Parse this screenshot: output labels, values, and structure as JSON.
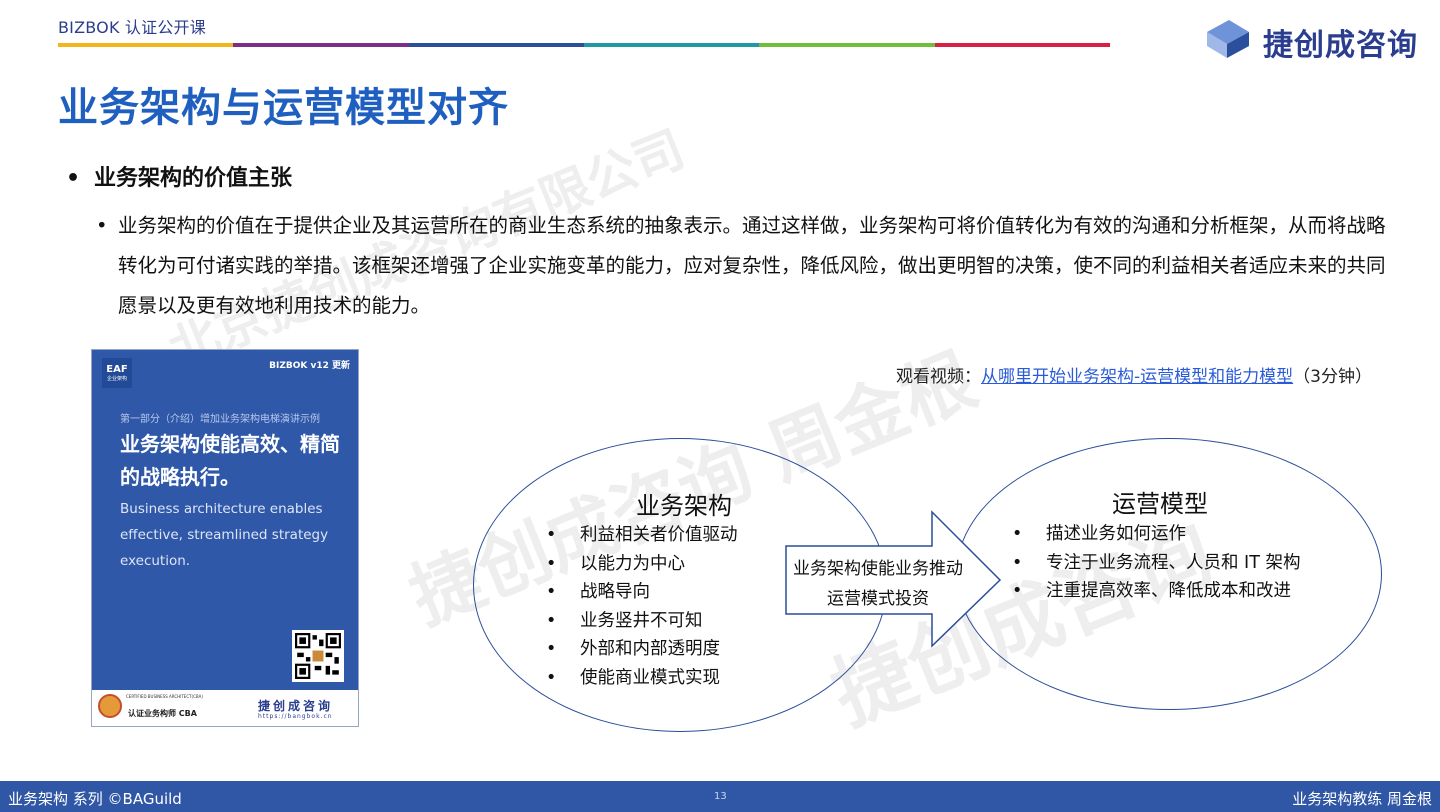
{
  "header": {
    "course_tag": "BIZBOK 认证公开课",
    "brand_name": "捷创成咨询",
    "rainbow_colors": [
      "#f2b51b",
      "#7d2d8a",
      "#2a4f9b",
      "#1f9aa5",
      "#6fbf3a",
      "#d81f44"
    ]
  },
  "title": "业务架构与运营模型对齐",
  "bullets": {
    "heading": "业务架构的价值主张",
    "body": "业务架构的价值在于提供企业及其运营所在的商业生态系统的抽象表示。通过这样做，业务架构可将价值转化为有效的沟通和分析框架，从而将战略转化为可付诸实践的举措。该框架还增强了企业实施变革的能力，应对复杂性，降低风险，做出更明智的决策，使不同的利益相关者适应未来的共同愿景以及更有效地利用技术的能力。"
  },
  "watermarks": [
    "北京捷创成咨询有限公司",
    "捷创成咨询 周金根",
    "捷创成咨询"
  ],
  "book": {
    "badge": "EAF",
    "badge_sub": "企业架构",
    "version": "BIZBOK v12 更新",
    "part": "第一部分（介绍）增加业务架构电梯演讲示例",
    "title": "业务架构使能高效、精简的战略执行。",
    "subtitle_en": "Business architecture enables effective, streamlined strategy execution.",
    "cert_small": "CERTIFIED BUSINESS ARCHITECT(CBA)",
    "cert": "认证业务构师 CBA",
    "brand": "捷创成咨询",
    "url": "https://bangbok.cn"
  },
  "video": {
    "prefix": "观看视频：",
    "link": "从哪里开始业务架构-运营模型和能力模型",
    "suffix": "（3分钟）"
  },
  "diagram": {
    "left_title": "业务架构",
    "left_items": [
      "利益相关者价值驱动",
      "以能力为中心",
      "战略导向",
      "业务竖井不可知",
      "外部和内部透明度",
      "使能商业模式实现"
    ],
    "arrow_text": "业务架构使能业务推动运营模式投资",
    "right_title": "运营模型",
    "right_items": [
      "描述业务如何运作",
      "专注于业务流程、人员和 IT 架构",
      "注重提高效率、降低成本和改进"
    ]
  },
  "footer": {
    "left": "业务架构 系列 ©BAGuild",
    "page": "13",
    "right": "业务架构教练 周金根"
  }
}
